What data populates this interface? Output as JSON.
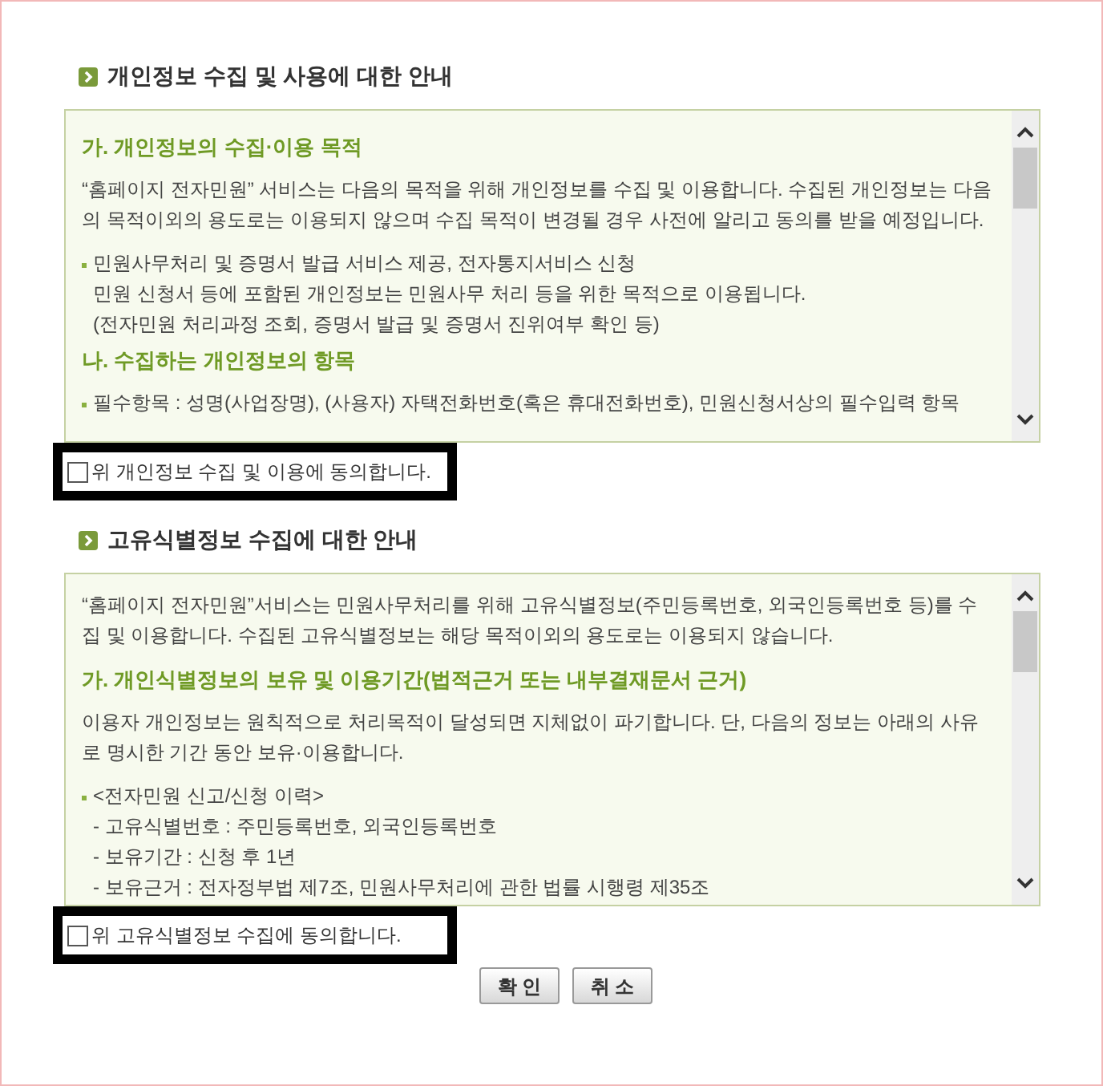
{
  "sections": [
    {
      "title": "개인정보 수집 및 사용에 대한 안내",
      "content": [
        {
          "kind": "heading",
          "text": "가. 개인정보의 수집·이용 목적"
        },
        {
          "kind": "paragraph",
          "text": "“홈페이지 전자민원” 서비스는 다음의 목적을 위해 개인정보를 수집 및 이용합니다. 수집된 개인정보는 다음의 목적이외의 용도로는 이용되지 않으며 수집 목적이 변경될 경우 사전에 알리고 동의를 받을 예정입니다."
        },
        {
          "kind": "bullet",
          "text": "민원사무처리 및 증명서 발급 서비스 제공, 전자통지서비스 신청"
        },
        {
          "kind": "line",
          "text": "민원 신청서 등에 포함된 개인정보는 민원사무 처리 등을 위한 목적으로 이용됩니다."
        },
        {
          "kind": "line",
          "text": "(전자민원 처리과정 조회, 증명서 발급 및 증명서 진위여부 확인 등)"
        },
        {
          "kind": "heading",
          "text": "나. 수집하는 개인정보의 항목"
        },
        {
          "kind": "bullet",
          "text": "필수항목 : 성명(사업장명), (사용자) 자택전화번호(혹은 휴대전화번호), 민원신청서상의 필수입력 항목"
        }
      ],
      "agreement": {
        "label": "위 개인정보 수집 및 이용에 동의합니다.",
        "checked": false
      }
    },
    {
      "title": "고유식별정보 수집에 대한 안내",
      "content": [
        {
          "kind": "paragraph",
          "text": "“홈페이지 전자민원”서비스는 민원사무처리를 위해 고유식별정보(주민등록번호, 외국인등록번호 등)를 수집 및 이용합니다. 수집된 고유식별정보는 해당 목적이외의 용도로는 이용되지 않습니다."
        },
        {
          "kind": "heading",
          "text": "가. 개인식별정보의 보유 및 이용기간(법적근거 또는 내부결재문서 근거)"
        },
        {
          "kind": "paragraph",
          "text": "이용자 개인정보는 원칙적으로 처리목적이 달성되면 지체없이 파기합니다. 단, 다음의 정보는 아래의 사유로 명시한 기간 동안 보유·이용합니다."
        },
        {
          "kind": "bullet",
          "text": "<전자민원 신고/신청 이력>"
        },
        {
          "kind": "line",
          "text": "- 고유식별번호 : 주민등록번호, 외국인등록번호"
        },
        {
          "kind": "line",
          "text": "- 보유기간 : 신청 후 1년"
        },
        {
          "kind": "line",
          "text": "- 보유근거 : 전자정부법 제7조, 민원사무처리에 관한 법률 시행령 제35조"
        }
      ],
      "agreement": {
        "label": "위 고유식별정보 수집에 동의합니다.",
        "checked": false
      }
    }
  ],
  "buttons": [
    "확 인",
    "취 소"
  ]
}
